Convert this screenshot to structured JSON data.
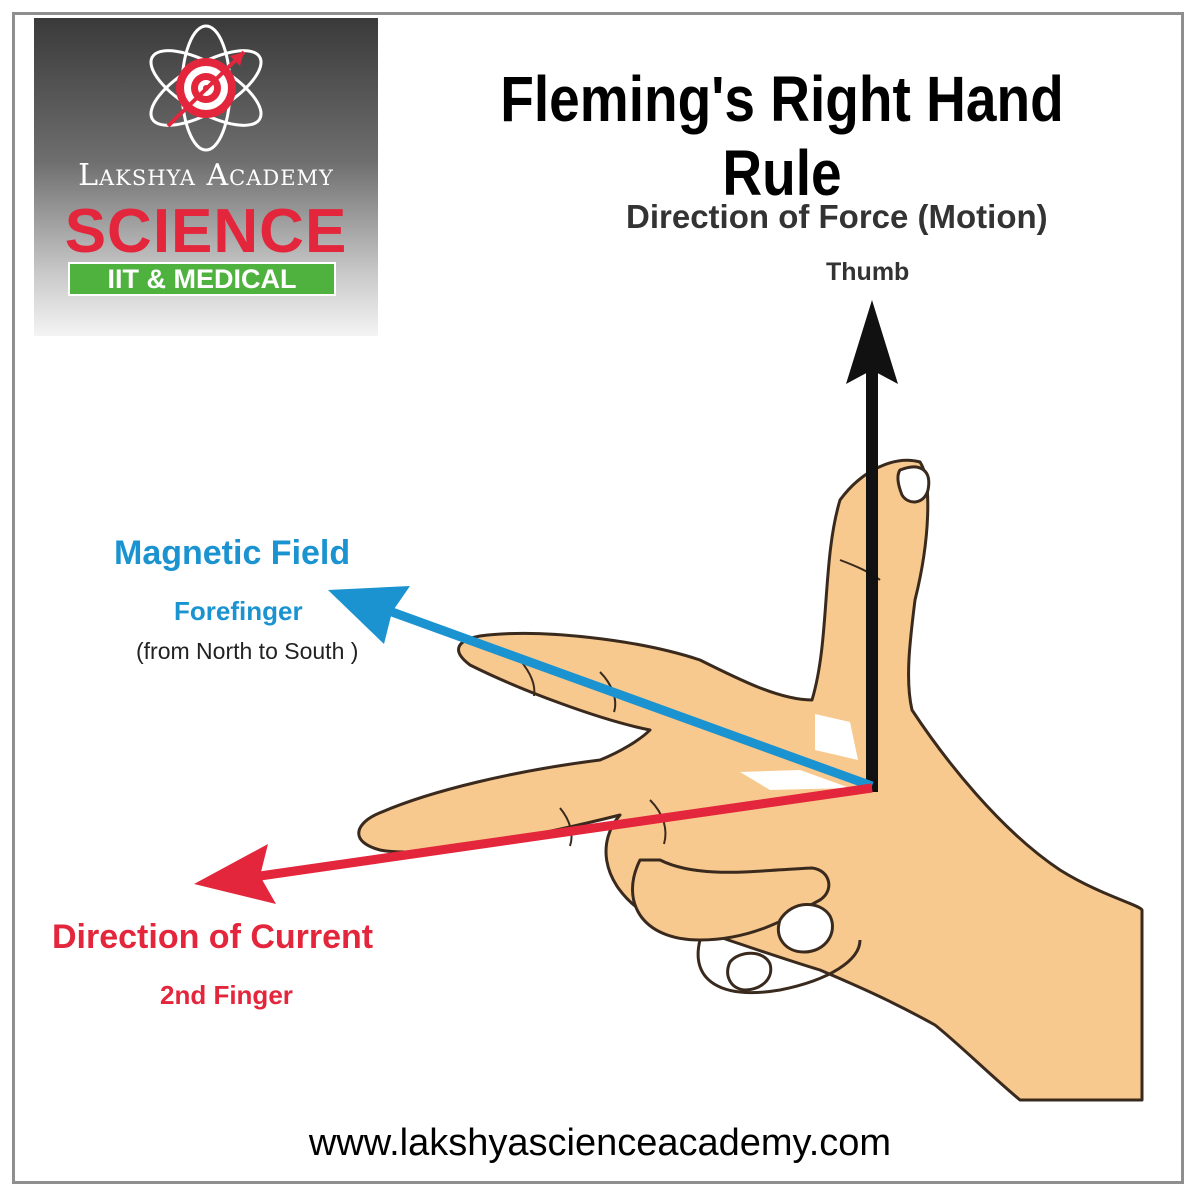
{
  "logo": {
    "academy": "Lakshya Academy",
    "science": "SCIENCE",
    "band": "IIT & MEDICAL",
    "icon": "atom-target-icon"
  },
  "title": "Fleming's Right Hand Rule",
  "labels": {
    "force": "Direction of Force (Motion)",
    "thumb": "Thumb",
    "magnetic": "Magnetic Field",
    "forefinger": "Forefinger",
    "north_south": "(from North to South )",
    "current": "Direction of Current",
    "second_finger": "2nd Finger"
  },
  "footer": {
    "url": "www.lakshyascienceacademy.com"
  },
  "colors": {
    "force_arrow": "#111111",
    "field_arrow": "#1a93d0",
    "current_arrow": "#e3263b",
    "skin": "#f7c98e",
    "skin_outline": "#3a2a1e"
  }
}
